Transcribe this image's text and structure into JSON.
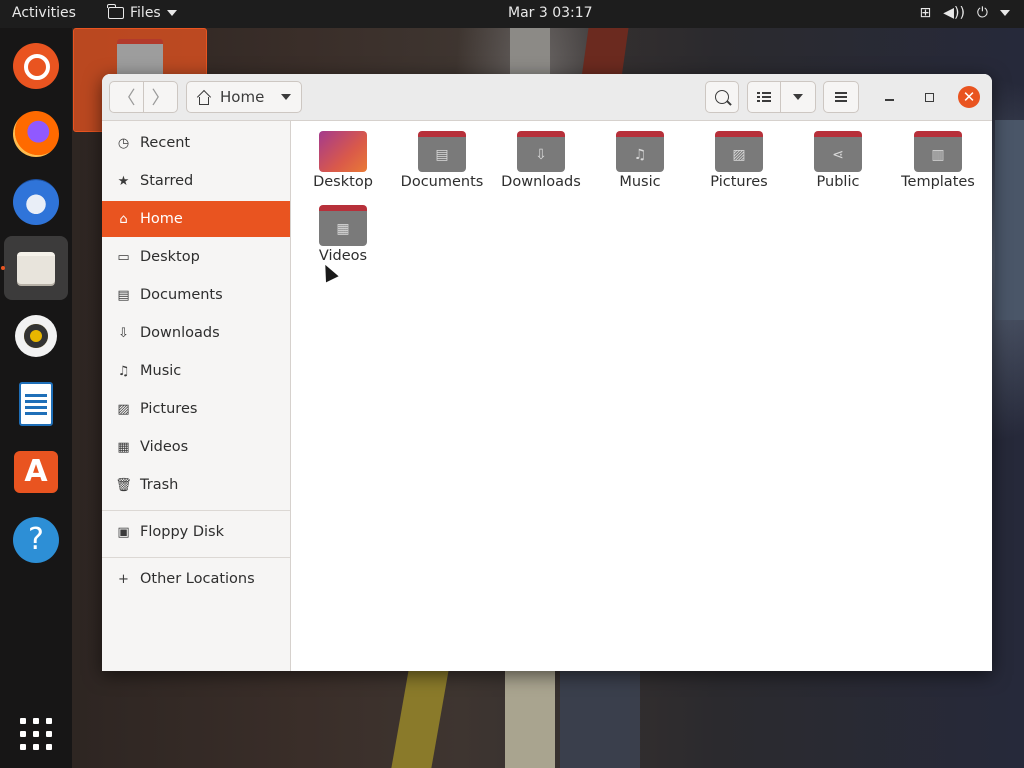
{
  "topbar": {
    "activities": "Activities",
    "app_menu": "Files",
    "clock": "Mar 3  03:17"
  },
  "dock": {
    "items": [
      {
        "name": "ubuntu-logo-icon"
      },
      {
        "name": "firefox-icon"
      },
      {
        "name": "thunderbird-icon"
      },
      {
        "name": "files-icon"
      },
      {
        "name": "rhythmbox-icon"
      },
      {
        "name": "libreoffice-writer-icon"
      },
      {
        "name": "ubuntu-software-icon"
      },
      {
        "name": "help-icon"
      }
    ],
    "show_apps": "show-applications-icon"
  },
  "window": {
    "path": "Home",
    "close_glyph": "✕"
  },
  "sidebar": {
    "items": [
      {
        "label": "Recent",
        "icon": "clock-icon",
        "glyph": "◷"
      },
      {
        "label": "Starred",
        "icon": "star-icon",
        "glyph": "★"
      },
      {
        "label": "Home",
        "icon": "home-icon",
        "glyph": "⌂"
      },
      {
        "label": "Desktop",
        "icon": "desktop-icon",
        "glyph": "▭"
      },
      {
        "label": "Documents",
        "icon": "document-icon",
        "glyph": "▤"
      },
      {
        "label": "Downloads",
        "icon": "download-icon",
        "glyph": "⇩"
      },
      {
        "label": "Music",
        "icon": "music-icon",
        "glyph": "♫"
      },
      {
        "label": "Pictures",
        "icon": "picture-icon",
        "glyph": "▨"
      },
      {
        "label": "Videos",
        "icon": "video-icon",
        "glyph": "▦"
      },
      {
        "label": "Trash",
        "icon": "trash-icon",
        "glyph": "🗑"
      },
      {
        "label": "Floppy Disk",
        "icon": "floppy-disk-icon",
        "glyph": "▣"
      },
      {
        "label": "Other Locations",
        "icon": "plus-icon",
        "glyph": "+"
      }
    ],
    "active": "Home"
  },
  "files": [
    {
      "label": "Desktop",
      "emblem": ""
    },
    {
      "label": "Documents",
      "emblem": "▤"
    },
    {
      "label": "Downloads",
      "emblem": "⇩"
    },
    {
      "label": "Music",
      "emblem": "♫"
    },
    {
      "label": "Pictures",
      "emblem": "▨"
    },
    {
      "label": "Public",
      "emblem": "⋖"
    },
    {
      "label": "Templates",
      "emblem": "▥"
    },
    {
      "label": "Videos",
      "emblem": "▦"
    }
  ],
  "colors": {
    "accent": "#e95420",
    "folder_body": "#7a7a7a",
    "folder_tab": "#b7303a"
  }
}
